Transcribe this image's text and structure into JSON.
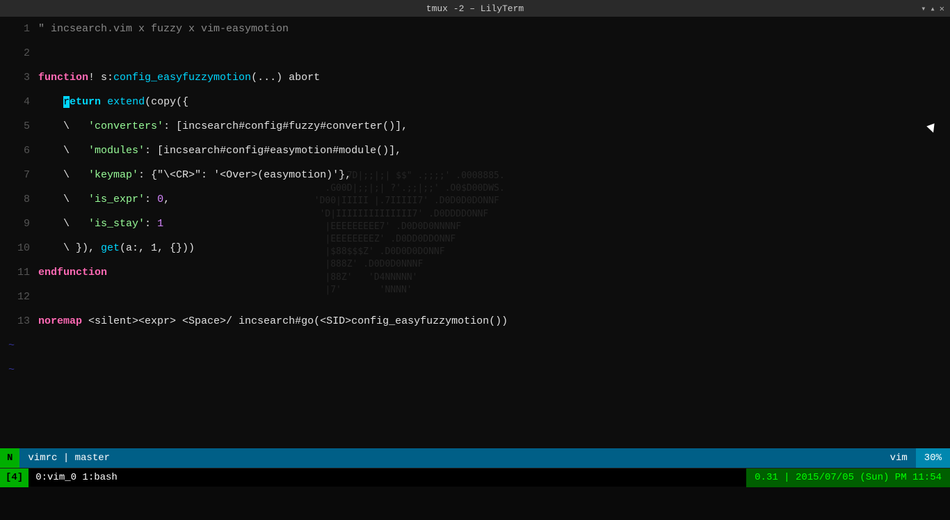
{
  "titlebar": {
    "title": "tmux -2 – LilyTerm",
    "controls": [
      "▾",
      "▴",
      "✕"
    ]
  },
  "editor": {
    "lines": [
      {
        "num": "1",
        "tokens": [
          {
            "text": "\" incsearch.vim x fuzzy x vim-easymotion",
            "class": "c-comment"
          }
        ]
      },
      {
        "num": "2",
        "tokens": []
      },
      {
        "num": "3",
        "tokens": [
          {
            "text": "function",
            "class": "c-keyword"
          },
          {
            "text": "! s:",
            "class": "c-normal"
          },
          {
            "text": "config_easyfuzzymotion",
            "class": "c-func-name"
          },
          {
            "text": "(...)",
            "class": "c-normal"
          },
          {
            "text": " abort",
            "class": "c-normal"
          }
        ]
      },
      {
        "num": "4",
        "tokens": [
          {
            "text": "    ",
            "class": "c-normal"
          },
          {
            "text": "r",
            "class": "cursor-char",
            "cursor": true
          },
          {
            "text": "eturn",
            "class": "c-return-rest"
          },
          {
            "text": " extend",
            "class": "c-extend"
          },
          {
            "text": "(",
            "class": "c-normal"
          },
          {
            "text": "copy",
            "class": "c-normal"
          },
          {
            "text": "({",
            "class": "c-normal"
          }
        ]
      },
      {
        "num": "5",
        "tokens": [
          {
            "text": "    \\ ",
            "class": "c-backslash"
          },
          {
            "text": "  'converters': [incsearch#config#fuzzy#converter()],",
            "class": "c-string-line"
          }
        ]
      },
      {
        "num": "6",
        "tokens": [
          {
            "text": "    \\ ",
            "class": "c-backslash"
          },
          {
            "text": "  'modules': [incsearch#config#easymotion#module()],",
            "class": "c-string-line"
          }
        ]
      },
      {
        "num": "7",
        "tokens": [
          {
            "text": "    \\ ",
            "class": "c-backslash"
          },
          {
            "text": "  'keymap': {\"\\<CR>\": '<Over>(easymotion)'},",
            "class": "c-string-line"
          }
        ]
      },
      {
        "num": "8",
        "tokens": [
          {
            "text": "    \\ ",
            "class": "c-backslash"
          },
          {
            "text": "  'is_expr': ",
            "class": "c-string-line"
          },
          {
            "text": "0",
            "class": "c-number"
          },
          {
            "text": ",",
            "class": "c-normal"
          }
        ]
      },
      {
        "num": "9",
        "tokens": [
          {
            "text": "    \\ ",
            "class": "c-backslash"
          },
          {
            "text": "  'is_stay': ",
            "class": "c-string-line"
          },
          {
            "text": "1",
            "class": "c-number"
          }
        ]
      },
      {
        "num": "10",
        "tokens": [
          {
            "text": "    \\ }), get(a:, 1, {}))",
            "class": "c-normal"
          }
        ]
      },
      {
        "num": "11",
        "tokens": [
          {
            "text": "endfunction",
            "class": "c-keyword"
          }
        ]
      },
      {
        "num": "12",
        "tokens": []
      },
      {
        "num": "13",
        "tokens": [
          {
            "text": "noremap",
            "class": "c-keyword"
          },
          {
            "text": " <silent><expr> <Space>/ incsearch#go(<SID>config_easyfuzzymotion())",
            "class": "c-normal"
          }
        ]
      }
    ],
    "tildes": [
      "~",
      "~"
    ],
    "watermark_lines": [
      "                  ,7D|;;|;| $$\" .;;;;' .0008885.",
      "               .G00D|;;|;| ?'.;;|;;' .O0$D00DWS.",
      "             'D00|IIIII |.7IIIII7' .D0D0D0DONNF",
      "              'D|IIIIIIIIIIIIII7' .D0DDDDONNF",
      "               |EEEEEEEEE7' .D0D0D0NNNNF",
      "               |EEEEEEEEZ' .D0DD0DDONNF",
      "               |$88$$$Z' .D0D0D0DONNF",
      "               |888Z' .D0D0D0NNNF",
      "               |88Z'   'D4NNNNN'",
      "               |7'       'NNNN'"
    ]
  },
  "statusline": {
    "mode": "N",
    "file": "vimrc | master",
    "filetype": "vim",
    "percent": "30%"
  },
  "tmuxbar": {
    "window_id": "[4]",
    "panes": "0:vim_0  1:bash",
    "info": "0.31 | 2015/07/05 (Sun) PM 11:54"
  }
}
